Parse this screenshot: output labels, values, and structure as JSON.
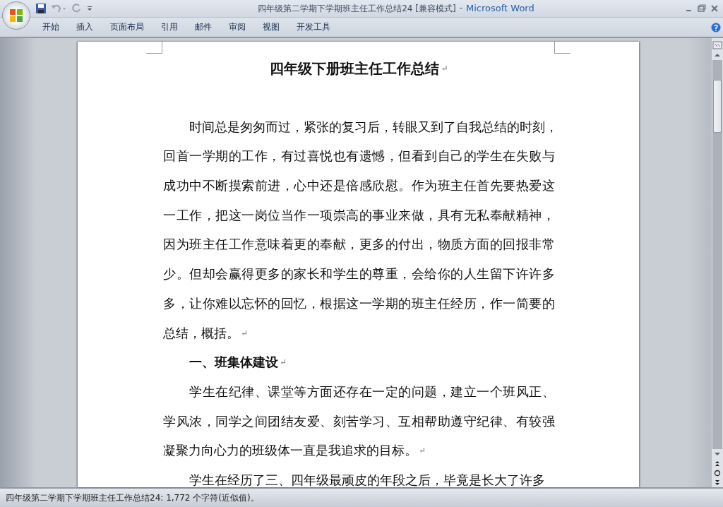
{
  "window": {
    "title": "四年级第二学期下学期班主任工作总结24 [兼容模式]",
    "separator": "-",
    "app": "Microsoft Word"
  },
  "ribbon_tabs": [
    {
      "label": "开始",
      "selected": false
    },
    {
      "label": "插入",
      "selected": false
    },
    {
      "label": "页面布局",
      "selected": false
    },
    {
      "label": "引用",
      "selected": false
    },
    {
      "label": "邮件",
      "selected": false
    },
    {
      "label": "审阅",
      "selected": false
    },
    {
      "label": "视图",
      "selected": false
    },
    {
      "label": "开发工具",
      "selected": false
    }
  ],
  "document": {
    "blocks": [
      {
        "kind": "title",
        "lines": [
          "四年级下册班主任工作总结"
        ],
        "paragraph_mark": "↵"
      },
      {
        "kind": "paragraph",
        "lines": [
          "时间总是匆匆而过，紧张的复习后，转眼又到了自我总结的时刻，",
          "回首一学期的工作，有过喜悦也有遗憾，但看到自己的学生在失败与",
          "成功中不断摸索前进，心中还是倍感欣慰。作为班主任首先要热爱这",
          "一工作，把这一岗位当作一项崇高的事业来做，具有无私奉献精神，",
          "因为班主任工作意味着更的奉献，更多的付出，物质方面的回报非常",
          "少。但却会赢得更多的家长和学生的尊重，会给你的人生留下许许多",
          "多，让你难以忘怀的回忆，根据这一学期的班主任经历，作一简要的",
          "总结，概括。"
        ],
        "paragraph_mark": "↵"
      },
      {
        "kind": "heading",
        "lines": [
          "一、班集体建设"
        ],
        "paragraph_mark": "↵"
      },
      {
        "kind": "paragraph",
        "lines": [
          "学生在纪律、课堂等方面还存在一定的问题，建立一个班风正、",
          "学风浓，同学之间团结友爱、刻苦学习、互相帮助遵守纪律、有较强",
          "凝聚力向心力的班级体一直是我追求的目标。"
        ],
        "paragraph_mark": "↵"
      },
      {
        "kind": "paragraph",
        "lines": [
          "学生在经历了三、四年级最顽皮的年段之后，毕竟是长大了许多"
        ]
      }
    ]
  },
  "status_bar": {
    "text": "四年级第二学期下学期班主任工作总结24: 1,772 个字符(近似值)。"
  }
}
